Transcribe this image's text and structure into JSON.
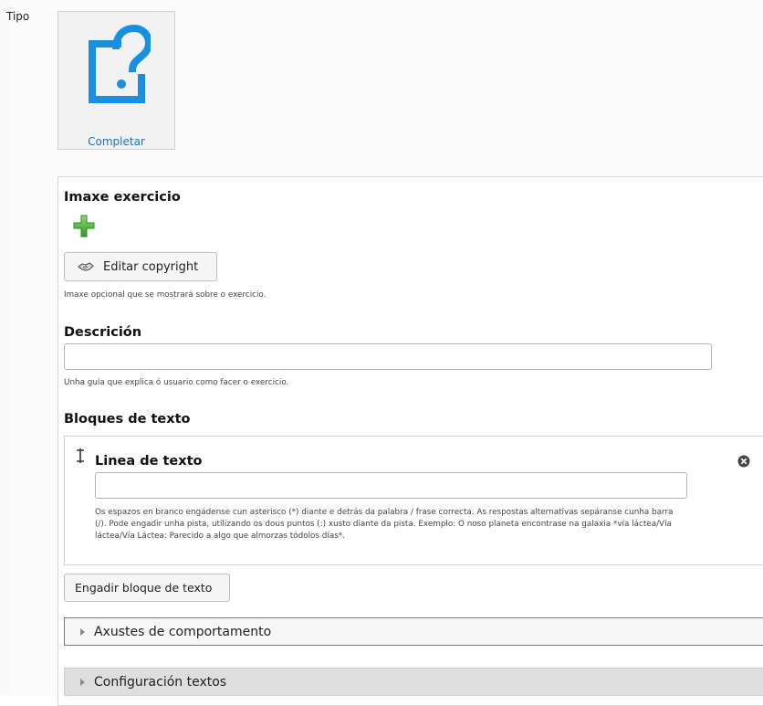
{
  "tipo": {
    "label": "Tipo"
  },
  "type_card": {
    "label": "Completar",
    "icon": "question-box-icon",
    "accent": "#1a8fe0"
  },
  "image_section": {
    "title": "Imaxe exercicio",
    "add_icon": "plus-icon",
    "copyright_button": "Editar copyright",
    "help": "Imaxe opcional que se mostrará sobre o exercicio."
  },
  "description_section": {
    "title": "Descrición",
    "value": "",
    "help": "Unha guía que explica ó usuario como facer o exercicio."
  },
  "text_blocks_section": {
    "title": "Bloques de texto",
    "block": {
      "title": "Linea de texto",
      "value": "",
      "help_lines": [
        "Os espazos en branco engádense cun asterisco (*) diante e detrás da palabra / frase correcta. As respostas alternativas sepáranse cunha barra",
        "(/). Pode engadir unha pista, utilizando os dous puntos (:) xusto diante da pista. Exemplo: O noso planeta encontrase na galaxia *vía láctea/Vía",
        "láctea/Vía Láctea: Parecido a algo que almorzas tódolos días*."
      ]
    },
    "add_button": "Engadir bloque de texto"
  },
  "collapsibles": [
    {
      "label": "Axustes de comportamento"
    },
    {
      "label": "Configuración textos"
    }
  ]
}
